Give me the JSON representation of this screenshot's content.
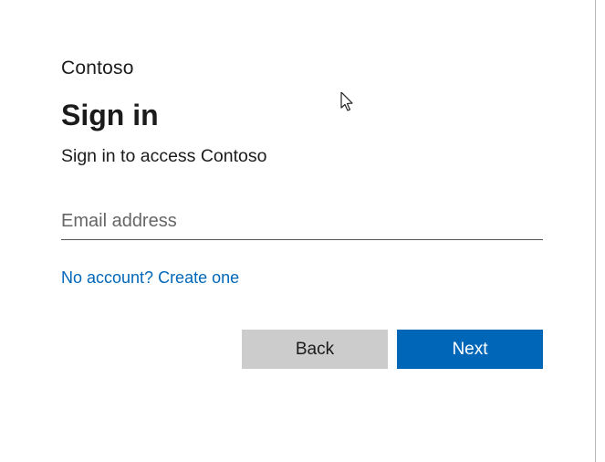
{
  "brand": "Contoso",
  "title": "Sign in",
  "subtitle": "Sign in to access Contoso",
  "email": {
    "value": "",
    "placeholder": "Email address"
  },
  "create_link": "No account? Create one",
  "buttons": {
    "back": "Back",
    "next": "Next"
  },
  "colors": {
    "accent": "#0067b8",
    "secondary_button": "#cccccc"
  }
}
